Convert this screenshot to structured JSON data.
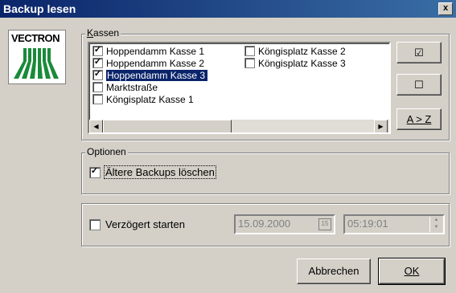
{
  "window": {
    "title": "Backup lesen",
    "close_label": "x"
  },
  "logo": {
    "text": "VECTRON",
    "color": "#1a8a3a"
  },
  "kassen": {
    "legend": "Kassen",
    "items": [
      {
        "label": "Hoppendamm Kasse 1",
        "checked": true,
        "selected": false
      },
      {
        "label": "Hoppendamm Kasse 2",
        "checked": true,
        "selected": false
      },
      {
        "label": "Hoppendamm Kasse 3",
        "checked": true,
        "selected": true
      },
      {
        "label": "Marktstraße",
        "checked": false,
        "selected": false
      },
      {
        "label": "Köngisplatz Kasse 1",
        "checked": false,
        "selected": false
      },
      {
        "label": "Köngisplatz Kasse 2",
        "checked": false,
        "selected": false
      },
      {
        "label": "Köngisplatz Kasse 3",
        "checked": false,
        "selected": false
      }
    ],
    "btn_check_all": "☑",
    "btn_uncheck_all": "☐",
    "btn_sort": "A > Z"
  },
  "optionen": {
    "legend": "Optionen",
    "older_backups_label": "Ältere Backups löschen",
    "older_backups_checked": true
  },
  "verzoegert": {
    "label": "Verzögert starten",
    "checked": false,
    "date": "15.09.2000",
    "time": "05:19:01"
  },
  "buttons": {
    "cancel": "Abbrechen",
    "ok": "OK"
  }
}
